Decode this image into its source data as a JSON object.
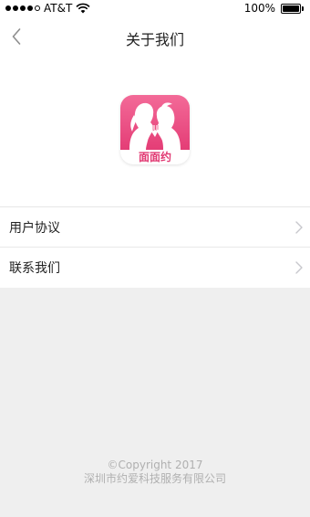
{
  "status_bar": {
    "carrier": "AT&T",
    "battery_percent": "100%",
    "battery_level": 1.0,
    "signal_icon": "signal-dots-icon",
    "wifi_icon": "wifi-icon",
    "battery_icon": "battery-icon"
  },
  "nav": {
    "title": "关于我们",
    "back_icon": "chevron-left-icon"
  },
  "logo": {
    "text": "面面约",
    "brand_color": "#e43d76"
  },
  "menu": {
    "items": [
      {
        "label": "用户协议",
        "icon": "chevron-right-icon"
      },
      {
        "label": "联系我们",
        "icon": "chevron-right-icon"
      }
    ]
  },
  "footer": {
    "copyright": "©Copyright 2017",
    "company": "深圳市约爱科技服务有限公司"
  }
}
